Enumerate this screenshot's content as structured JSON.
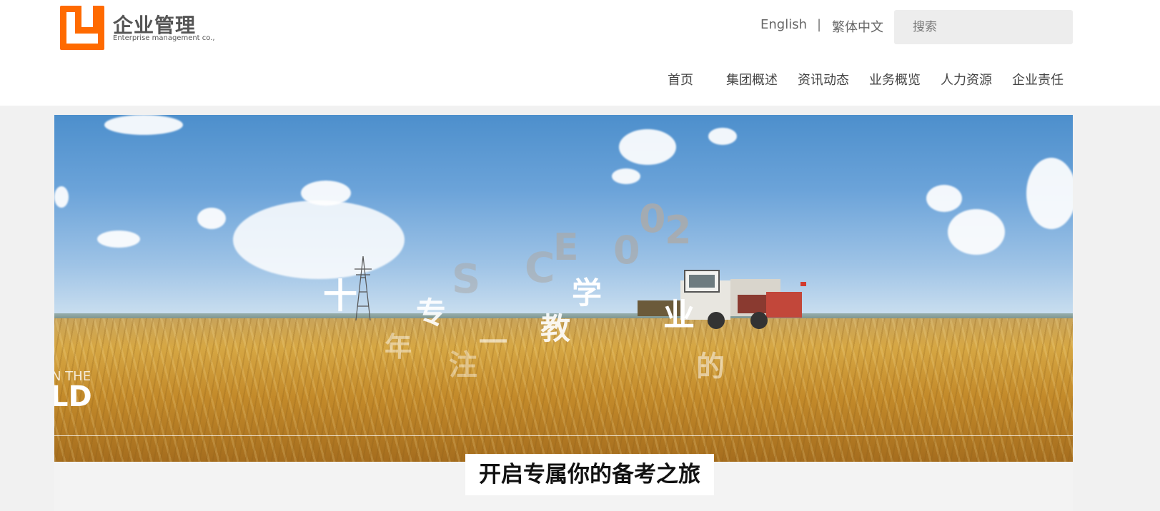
{
  "logo": {
    "title": "企业管理",
    "subtitle": "Enterprise management co.,"
  },
  "header": {
    "lang_english": "English",
    "lang_separator": "|",
    "lang_traditional": "繁体中文",
    "search_placeholder": "搜索"
  },
  "nav": {
    "items": [
      {
        "label": "首页"
      },
      {
        "label": "集团概述"
      },
      {
        "label": "资讯动态"
      },
      {
        "label": "业务概览"
      },
      {
        "label": "人力资源"
      },
      {
        "label": "企业责任"
      }
    ]
  },
  "banner": {
    "overlay_chars": [
      "十",
      "专",
      "学",
      "业",
      "教",
      "年",
      "注",
      "一",
      "的",
      "S",
      "C",
      "E",
      "0",
      "0",
      "2"
    ],
    "corner_text_top": "N THE",
    "corner_text_big": "LD"
  },
  "tagline": "开启专属你的备考之旅",
  "colors": {
    "brand": "#ff6a00",
    "nav_text": "#444444",
    "search_bg": "#ededed",
    "page_bg": "#f1f1f1"
  }
}
